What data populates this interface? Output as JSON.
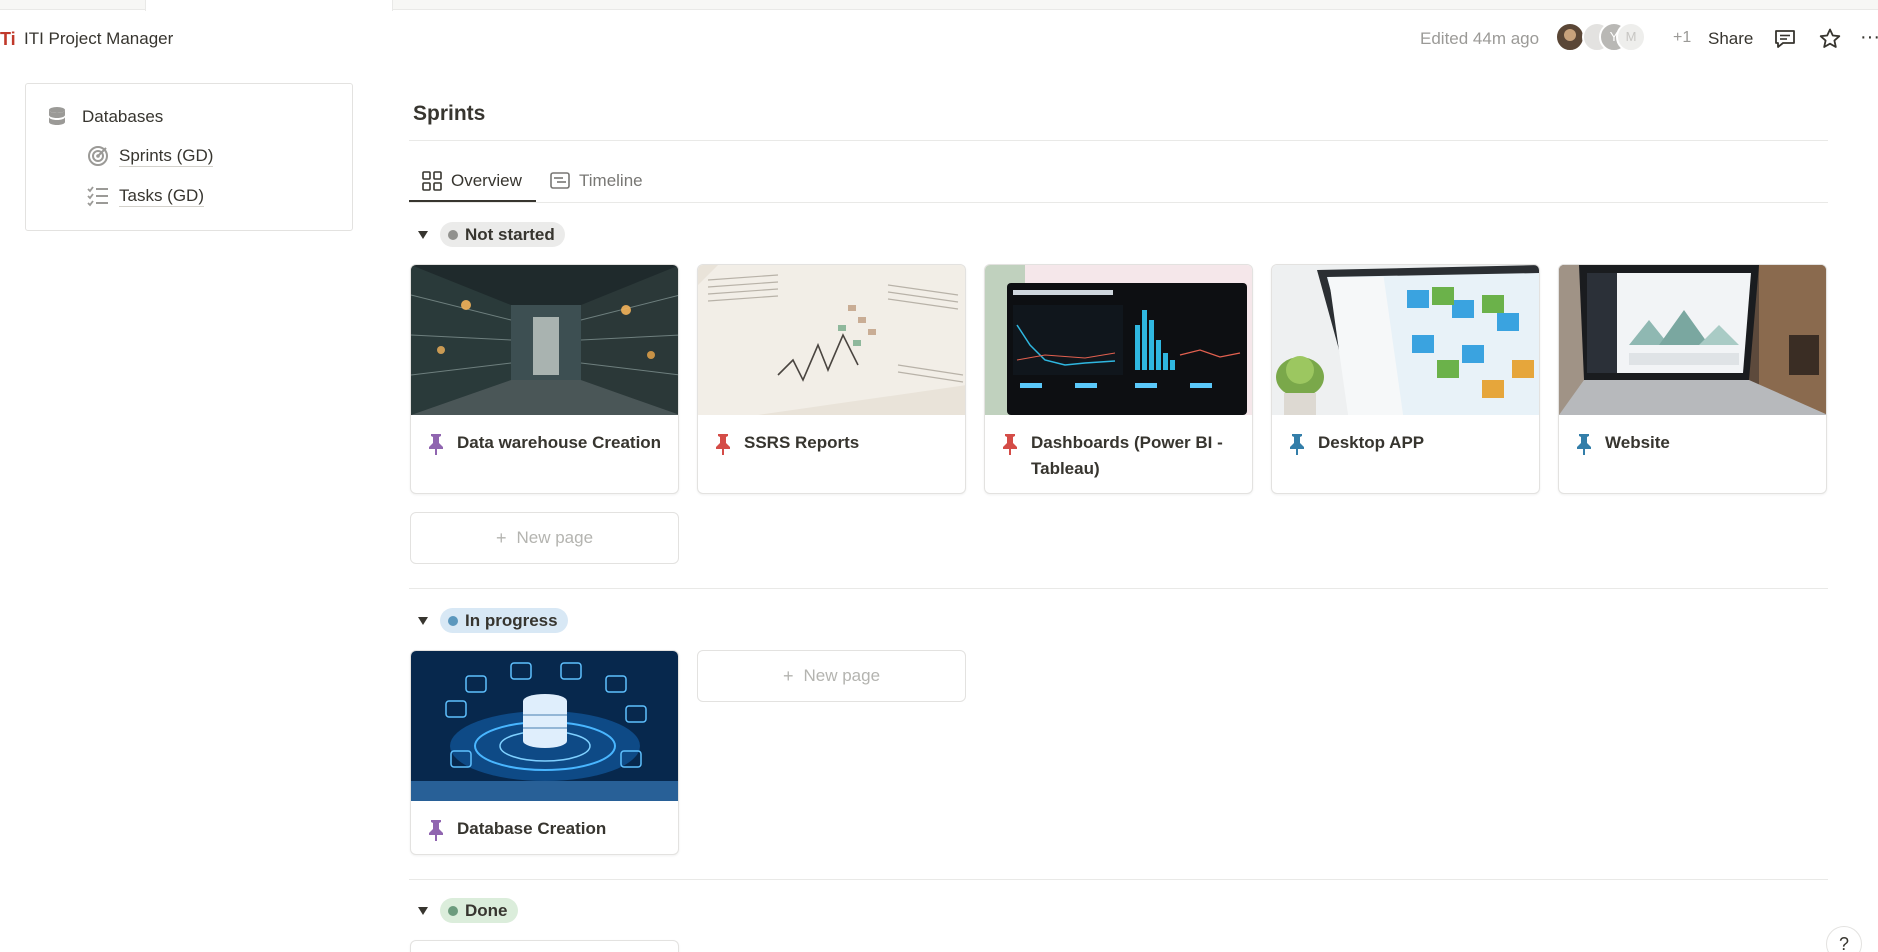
{
  "app": {
    "title": "ITI Project Manager",
    "logo_text": "Ti"
  },
  "header": {
    "edited": "Edited 44m ago",
    "avatars": [
      "",
      "",
      "Y",
      "M"
    ],
    "extra_count": "+1",
    "share_label": "Share",
    "more_label": "···"
  },
  "sidebar": {
    "title": "Databases",
    "items": [
      {
        "label": "Sprints (GD)",
        "icon": "target-icon"
      },
      {
        "label": "Tasks (GD)",
        "icon": "checklist-icon"
      }
    ]
  },
  "main": {
    "title": "Sprints",
    "tabs": [
      {
        "label": "Overview",
        "icon": "gallery-icon",
        "active": true
      },
      {
        "label": "Timeline",
        "icon": "timeline-icon",
        "active": false
      }
    ],
    "groups": [
      {
        "status": "Not started",
        "color": "#91918e",
        "cards": [
          {
            "title": "Data warehouse Creation",
            "pin_color": "#9065b0",
            "image": "server-room"
          },
          {
            "title": "SSRS Reports",
            "pin_color": "#d44c47",
            "image": "paper-charts"
          },
          {
            "title": "Dashboards (Power BI - Tableau)",
            "pin_color": "#d44c47",
            "image": "dashboard-screen"
          },
          {
            "title": "Desktop APP",
            "pin_color": "#337ea9",
            "image": "tablet-finder"
          },
          {
            "title": "Website",
            "pin_color": "#337ea9",
            "image": "laptop-website"
          }
        ],
        "new_page_label": "New page"
      },
      {
        "status": "In progress",
        "color": "#5b97bd",
        "cards": [
          {
            "title": "Database Creation",
            "pin_color": "#9065b0",
            "image": "database-hologram"
          }
        ],
        "new_page_label": "New page"
      },
      {
        "status": "Done",
        "color": "#6c9b7d",
        "cards": []
      }
    ]
  },
  "help_label": "?"
}
